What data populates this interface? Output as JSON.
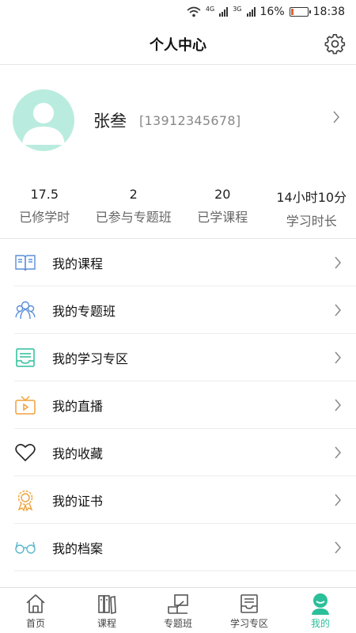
{
  "status_bar": {
    "net1": "4G",
    "net2": "3G",
    "battery_pct": "16%",
    "battery_level": 0.16,
    "time": "18:38"
  },
  "header": {
    "title": "个人中心",
    "settings_icon": "gear-icon"
  },
  "profile": {
    "name": "张叁",
    "phone": "[13912345678]",
    "avatar_icon": "person-icon"
  },
  "stats": [
    {
      "value": "17.5",
      "label": "已修学时"
    },
    {
      "value": "2",
      "label": "已参与专题班"
    },
    {
      "value": "20",
      "label": "已学课程"
    },
    {
      "value": "14小时10分",
      "label": "学习时长"
    }
  ],
  "menu": [
    {
      "label": "我的课程",
      "icon": "book-icon"
    },
    {
      "label": "我的专题班",
      "icon": "group-icon"
    },
    {
      "label": "我的学习专区",
      "icon": "tray-icon"
    },
    {
      "label": "我的直播",
      "icon": "tv-icon"
    },
    {
      "label": "我的收藏",
      "icon": "heart-icon"
    },
    {
      "label": "我的证书",
      "icon": "badge-icon"
    },
    {
      "label": "我的档案",
      "icon": "glasses-icon"
    }
  ],
  "tabs": [
    {
      "label": "首页",
      "icon": "home-icon",
      "active": false
    },
    {
      "label": "课程",
      "icon": "books-icon",
      "active": false
    },
    {
      "label": "专题班",
      "icon": "lectern-icon",
      "active": false
    },
    {
      "label": "学习专区",
      "icon": "inbox-icon",
      "active": false
    },
    {
      "label": "我的",
      "icon": "user-icon",
      "active": true
    }
  ],
  "colors": {
    "accent": "#2bbf9a",
    "avatar_bg": "#b9ecdf"
  }
}
